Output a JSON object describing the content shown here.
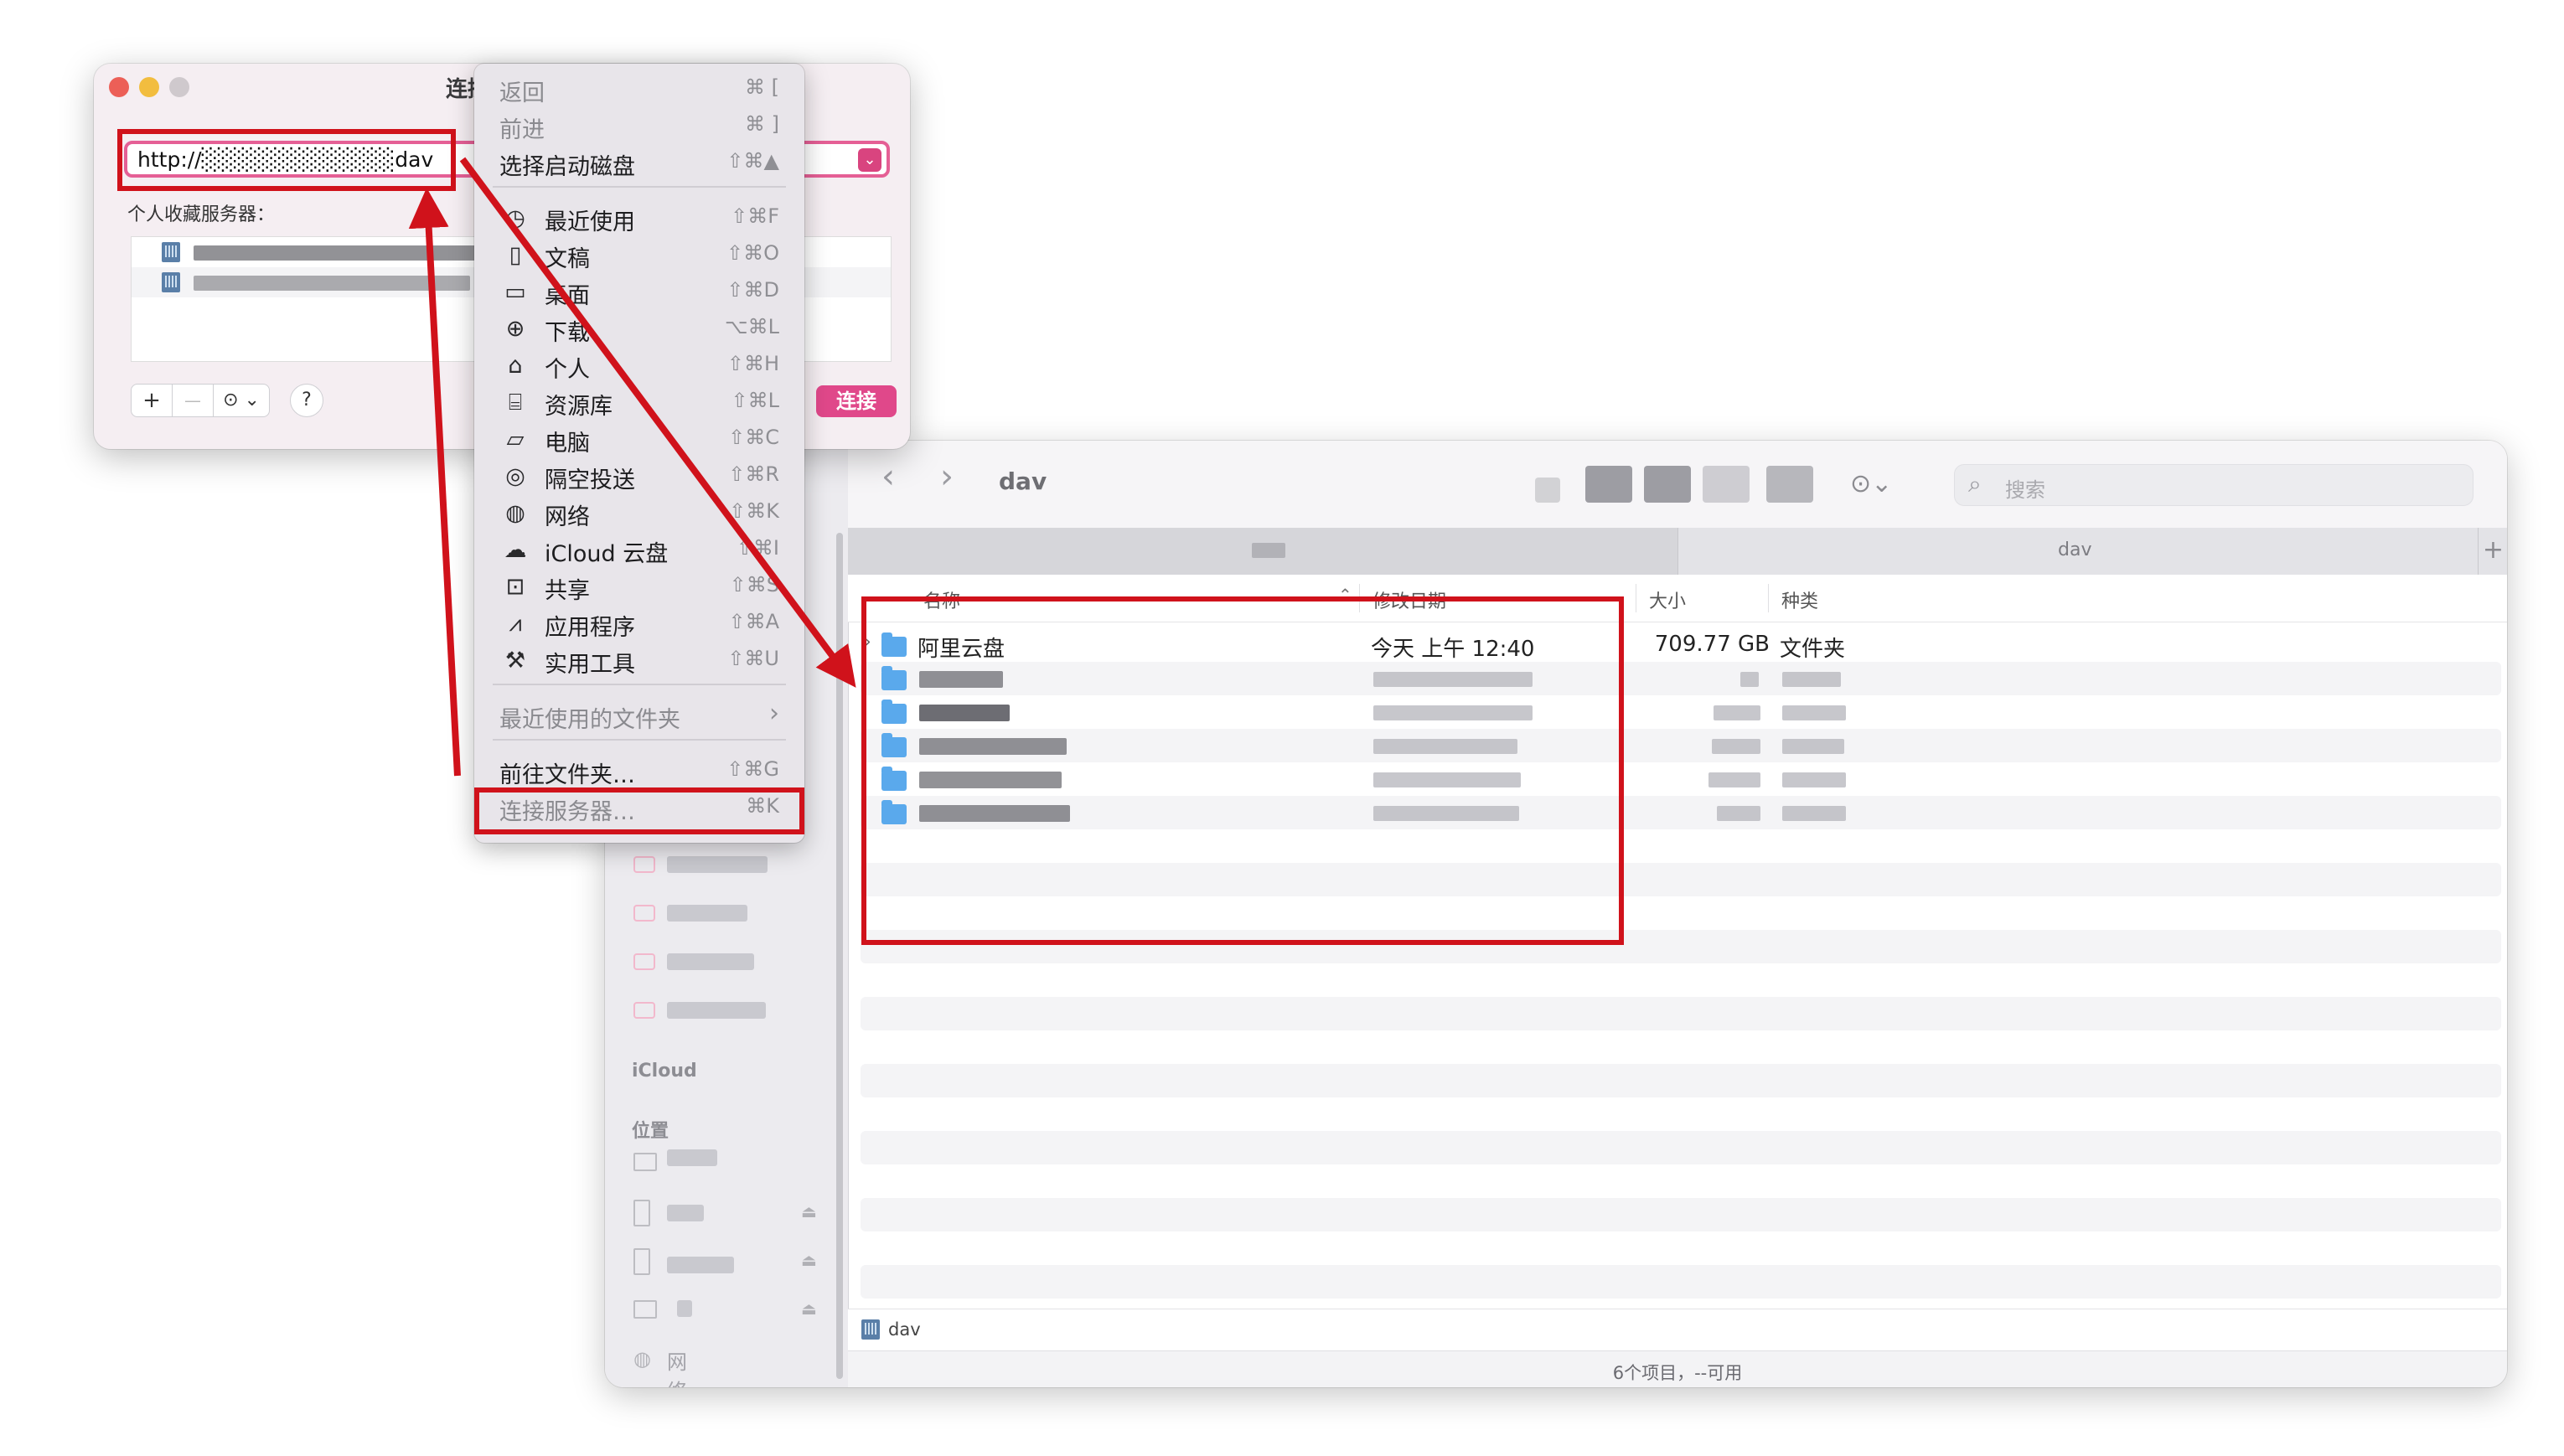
{
  "dialog": {
    "title": "连接",
    "url": "http://░░░░░░░░░░░░dav",
    "favorites_label": "个人收藏服务器：",
    "add": "+",
    "remove": "—",
    "more": "⊙ ⌄",
    "help": "?",
    "connect": "连接"
  },
  "go_menu": {
    "items": [
      {
        "label": "返回",
        "shortcut": "⌘ [",
        "enabled": false
      },
      {
        "label": "前进",
        "shortcut": "⌘ ]",
        "enabled": false
      },
      {
        "label": "选择启动磁盘",
        "shortcut": "⇧⌘▲",
        "enabled": true
      },
      {
        "label": "最近使用",
        "shortcut": "⇧⌘F",
        "icon": "clock-icon"
      },
      {
        "label": "文稿",
        "shortcut": "⇧⌘O",
        "icon": "document-icon"
      },
      {
        "label": "桌面",
        "shortcut": "⇧⌘D",
        "icon": "desktop-icon"
      },
      {
        "label": "下载",
        "shortcut": "⌥⌘L",
        "icon": "download-icon"
      },
      {
        "label": "个人",
        "shortcut": "⇧⌘H",
        "icon": "home-icon"
      },
      {
        "label": "资源库",
        "shortcut": "⇧⌘L",
        "icon": "library-icon"
      },
      {
        "label": "电脑",
        "shortcut": "⇧⌘C",
        "icon": "computer-icon"
      },
      {
        "label": "隔空投送",
        "shortcut": "⇧⌘R",
        "icon": "airdrop-icon"
      },
      {
        "label": "网络",
        "shortcut": "⇧⌘K",
        "icon": "network-icon"
      },
      {
        "label": "iCloud 云盘",
        "shortcut": "⇧⌘I",
        "icon": "cloud-icon"
      },
      {
        "label": "共享",
        "shortcut": "⇧⌘S",
        "icon": "shared-folder-icon"
      },
      {
        "label": "应用程序",
        "shortcut": "⇧⌘A",
        "icon": "applications-icon"
      },
      {
        "label": "实用工具",
        "shortcut": "⇧⌘U",
        "icon": "utilities-icon"
      },
      {
        "label": "最近使用的文件夹",
        "shortcut": "›"
      },
      {
        "label": "前往文件夹…",
        "shortcut": "⇧⌘G"
      },
      {
        "label": "连接服务器…",
        "shortcut": "⌘K"
      }
    ]
  },
  "finder": {
    "path_title": "dav",
    "search_placeholder": "搜索",
    "tab_left": "",
    "tab_right": "dav",
    "new_tab": "+",
    "columns": {
      "name": "名称",
      "modified": "修改日期",
      "size": "大小",
      "kind": "种类"
    },
    "first_row": {
      "name": "阿里云盘",
      "modified": "今天 上午 12:40",
      "size": "709.77 GB",
      "kind": "文件夹"
    },
    "sidebar": {
      "icloud": "iCloud",
      "locations": "位置",
      "network": "网络"
    },
    "pathbar": "dav",
    "status": "6个项目，--可用"
  },
  "colors": {
    "accent_pink": "#e0488a",
    "annotation_red": "#d0121b",
    "folder_blue": "#5aa9ec"
  }
}
